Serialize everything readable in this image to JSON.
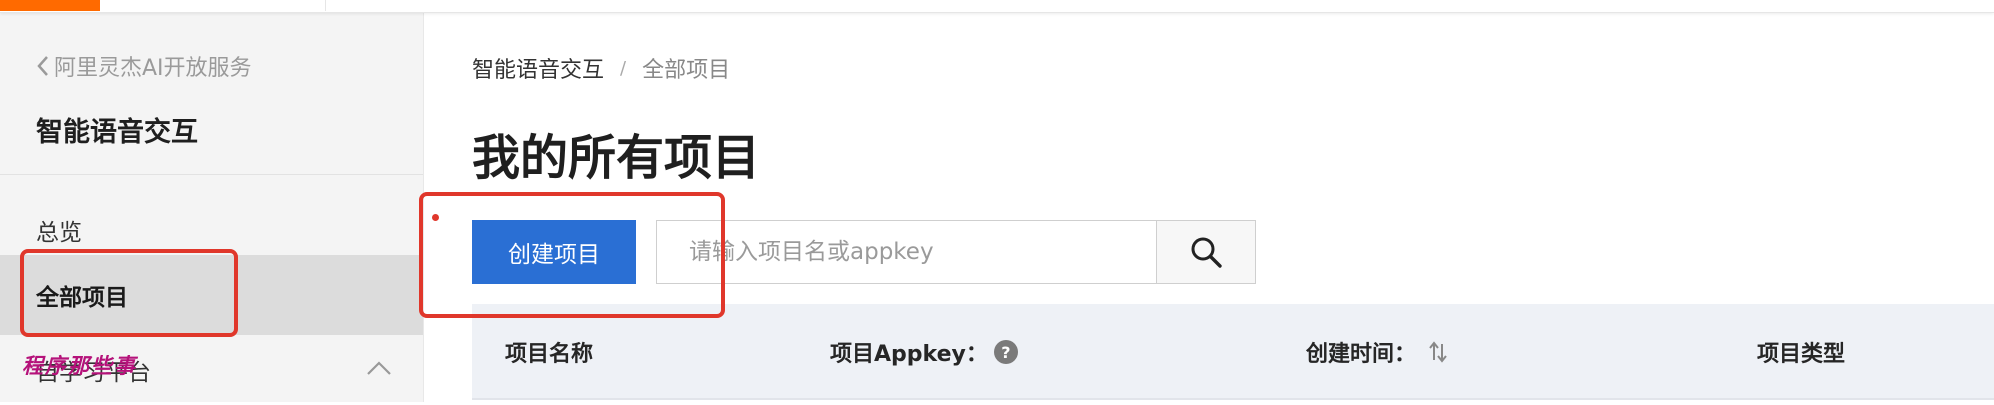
{
  "sidebar": {
    "back_label": "阿里灵杰AI开放服务",
    "product_title": "智能语音交互",
    "items": [
      {
        "label": "总览"
      },
      {
        "label": "全部项目",
        "active": true
      },
      {
        "label": "自学习平台",
        "expanded": true,
        "icon": "chevron-up-icon"
      }
    ]
  },
  "watermark": "程序那些事",
  "breadcrumb": {
    "root": "智能语音交互",
    "separator": "/",
    "current": "全部项目"
  },
  "page_title": "我的所有项目",
  "toolbar": {
    "create_label": "创建项目",
    "search_placeholder": "请输入项目名或appkey",
    "search_icon": "search-icon"
  },
  "table": {
    "columns": [
      {
        "label": "项目名称"
      },
      {
        "label": "项目Appkey：",
        "icon": "help-icon"
      },
      {
        "label": "创建时间：",
        "icon": "sort-icon"
      },
      {
        "label": "项目类型"
      }
    ]
  },
  "colors": {
    "accent": "#ff6a00",
    "primary_button": "#2a6fd4",
    "annotation": "#e0372b",
    "table_header_bg": "#eef1f6"
  }
}
